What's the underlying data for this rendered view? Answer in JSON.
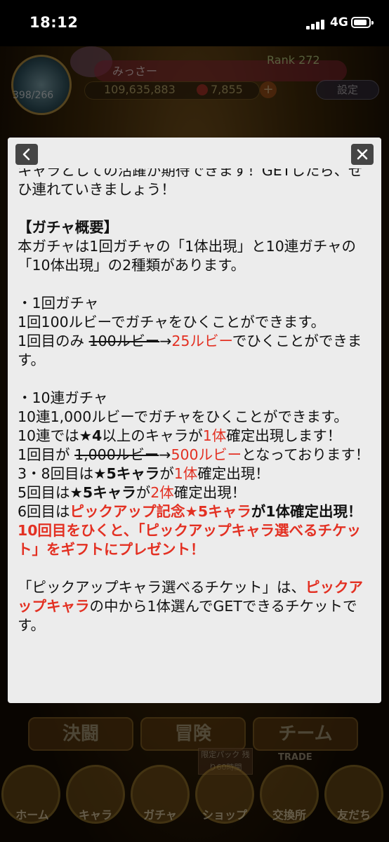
{
  "status_bar": {
    "time": "18:12",
    "network": "4G"
  },
  "game_hud": {
    "player_name": "みっさー",
    "rank": "Rank 272",
    "stamina": "398/266",
    "coins": "109,635,883",
    "rubies": "7,855",
    "settings_label": "設定"
  },
  "game_modes": {
    "duel": "決闘",
    "adventure": "冒険",
    "team": "チーム"
  },
  "bottom_nav": {
    "home": "ホーム",
    "chara": "キャラ",
    "gacha": "ガチャ",
    "shop": "ショップ",
    "exchange": "交換所",
    "friends": "友だち",
    "promo": "限定パック 残り60時間",
    "trade": "TRADE"
  },
  "modal": {
    "intro_partial": "キャラとしての活躍が期待できます！GETしたら、ぜひ連れていきましょう！",
    "overview_heading": "【ガチャ概要】",
    "overview_text": "本ガチャは1回ガチャの「1体出現」と10連ガチャの「10体出現」の2種類があります。",
    "single_heading": "・1回ガチャ",
    "single_text": "1回100ルビーでガチャをひくことができます。",
    "single_first_pre": "1回目のみ ",
    "single_first_old": "100ルビー",
    "single_first_arrow": "→",
    "single_first_new": "25ルビー",
    "single_first_post": "でひくことができます。",
    "ten_heading": "・10連ガチャ",
    "ten_text": "10連1,000ルビーでガチャをひくことができます。",
    "ten_guarantee_pre": "10連では",
    "ten_guarantee_star": "★4",
    "ten_guarantee_mid": "以上のキャラが",
    "ten_guarantee_num": "1体",
    "ten_guarantee_post": "確定出現します！",
    "ten_first_pre": "1回目が ",
    "ten_first_old": "1,000ルビー",
    "ten_first_arrow": "→",
    "ten_first_new": "500ルビー",
    "ten_first_post": "となっております！",
    "r38_pre": "3・8回目は",
    "r38_star": "★5キャラ",
    "r38_mid": "が",
    "r38_num": "1体",
    "r38_post": "確定出現！",
    "r5_pre": "5回目は",
    "r5_star": "★5キャラ",
    "r5_mid": "が",
    "r5_num": "2体",
    "r5_post": "確定出現！",
    "r6_pre": "6回目は",
    "r6_pickup": "ピックアップ記念★5キャラ",
    "r6_post": "が1体確定出現！",
    "r10_text": "10回目をひくと、「ピックアップキャラ選べるチケット」をギフトにプレゼント！",
    "ticket_pre": "「ピックアップキャラ選べるチケット」は、",
    "ticket_red": "ピックアップキャラ",
    "ticket_post": "の中から1体選んでGETできるチケットです。"
  }
}
